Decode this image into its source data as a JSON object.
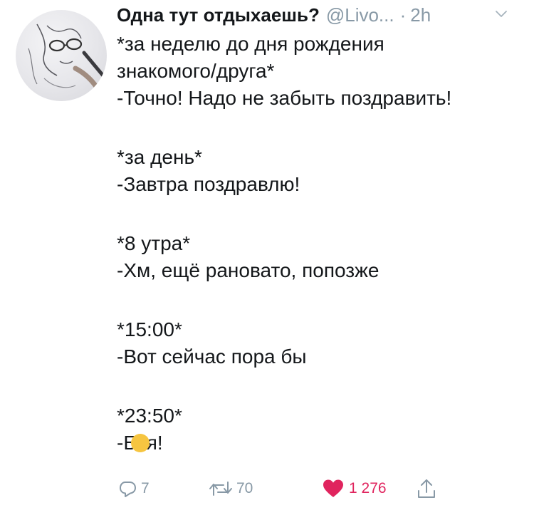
{
  "header": {
    "display_name": "Одна тут отдыхаешь?",
    "handle": "@Livo...",
    "separator": "·",
    "time": "2h"
  },
  "tweet": {
    "lines": [
      "*за неделю до дня рождения",
      "знакомого/друга*",
      "-Точно! Надо не забыть поздравить!",
      "",
      "*за день*",
      "-Завтра поздравлю!",
      "",
      "*8 утра*",
      "-Хм, ещё рановато, попозже",
      "",
      "*15:00*",
      "-Вот сейчас пора бы",
      "",
      "*23:50*"
    ],
    "last_line_start": "-Б",
    "last_line_end": "я!"
  },
  "actions": {
    "reply_count": "7",
    "retweet_count": "70",
    "like_count": "1 276"
  },
  "colors": {
    "text": "#14171a",
    "muted": "#8899a6",
    "like": "#e0245e",
    "emoji": "#f6c541"
  },
  "icons": {
    "avatar": "sketch-portrait",
    "menu": "chevron-down-icon",
    "reply": "reply-icon",
    "retweet": "retweet-icon",
    "like": "heart-icon",
    "share": "share-icon",
    "emoji_overlay": "emoji-face"
  }
}
